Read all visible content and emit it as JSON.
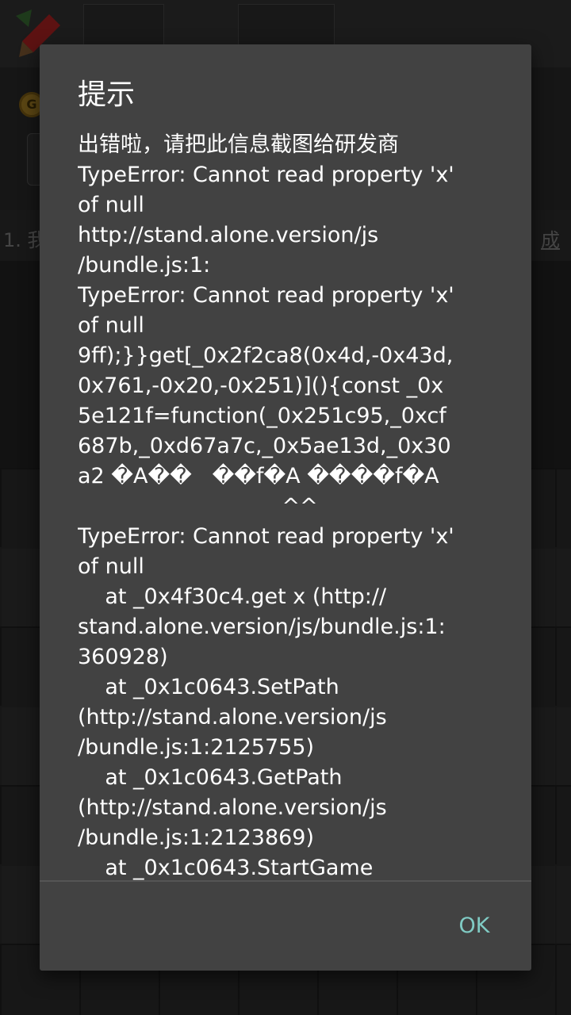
{
  "background": {
    "coin_glyph": "G",
    "strip_left_text": "1. 我",
    "strip_right_text": "成"
  },
  "dialog": {
    "title": "提示",
    "message_lines": [
      "出错啦，请把此信息截图给研发商",
      "TypeError: Cannot read property 'x'",
      "of null",
      "http://stand.alone.version/js",
      "/bundle.js:1:",
      "TypeError: Cannot read property 'x'",
      "of null",
      "9ff);}}get[_0x2f2ca8(0x4d,-0x43d,",
      "0x761,-0x20,-0x251)](){const _0x",
      "5e121f=function(_0x251c95,_0xcf",
      "687b,_0xd67a7c,_0x5ae13d,_0x30",
      "a2 �A��   ��f�A ����f�A",
      "                              ^^",
      "TypeError: Cannot read property 'x'",
      "of null",
      "    at _0x4f30c4.get x (http://",
      "stand.alone.version/js/bundle.js:1:",
      "360928)",
      "    at _0x1c0643.SetPath",
      "(http://stand.alone.version/js",
      "/bundle.js:1:2125755)",
      "    at _0x1c0643.GetPath",
      "(http://stand.alone.version/js",
      "/bundle.js:1:2123869)",
      "    at _0x1c0643.StartGame"
    ],
    "ok_label": "OK"
  },
  "colors": {
    "dialog_bg": "#424242",
    "text": "#ffffff",
    "accent": "#80cbc4"
  }
}
